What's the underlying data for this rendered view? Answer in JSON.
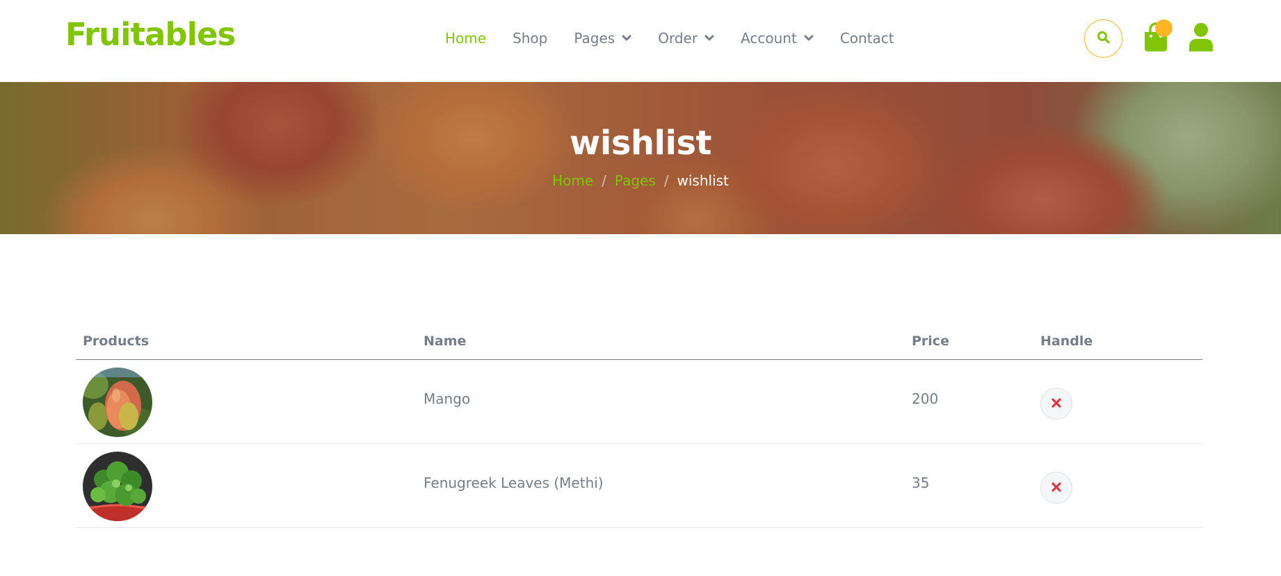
{
  "brand": {
    "name": "Fruitables",
    "accent_color": "#81c408",
    "secondary_color": "#ffb524"
  },
  "nav": {
    "items": [
      {
        "label": "Home",
        "active": true,
        "dropdown": false
      },
      {
        "label": "Shop",
        "active": false,
        "dropdown": false
      },
      {
        "label": "Pages",
        "active": false,
        "dropdown": true
      },
      {
        "label": "Order",
        "active": false,
        "dropdown": true
      },
      {
        "label": "Account",
        "active": false,
        "dropdown": true
      },
      {
        "label": "Contact",
        "active": false,
        "dropdown": false
      }
    ],
    "icons": [
      "search-icon",
      "shopping-bag-icon",
      "user-icon"
    ]
  },
  "hero": {
    "title": "wishlist",
    "breadcrumb": [
      "Home",
      "Pages",
      "wishlist"
    ]
  },
  "table": {
    "headers": [
      "Products",
      "Name",
      "Price",
      "Handle"
    ],
    "rows": [
      {
        "image": "mango-photo",
        "name": "Mango",
        "price": "200"
      },
      {
        "image": "fenugreek-leaves-photo",
        "name": "Fenugreek Leaves (Methi)",
        "price": "35"
      }
    ]
  }
}
